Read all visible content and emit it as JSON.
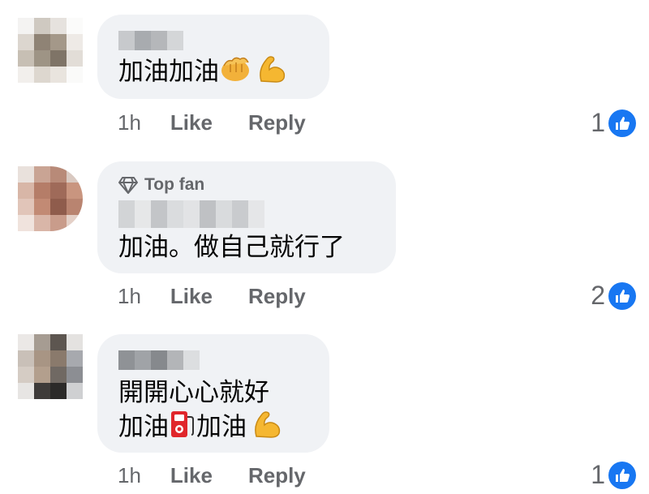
{
  "comments": [
    {
      "text_lines": [
        "加油加油"
      ],
      "emojis": [
        "fist-emoji",
        "flexed-bicep-emoji"
      ],
      "time": "1h",
      "like_label": "Like",
      "reply_label": "Reply",
      "reaction_count": "1"
    },
    {
      "badge": "Top fan",
      "text_lines": [
        "加油。做自己就行了"
      ],
      "time": "1h",
      "like_label": "Like",
      "reply_label": "Reply",
      "reaction_count": "2"
    },
    {
      "text_lines": [
        "開開心心就好",
        "加油",
        "加油"
      ],
      "emojis": [
        "fuel-pump-emoji",
        "flexed-bicep-emoji"
      ],
      "time": "1h",
      "like_label": "Like",
      "reply_label": "Reply",
      "reaction_count": "1"
    }
  ],
  "colors": {
    "bubble": "#f0f2f5",
    "secondary_text": "#65676b",
    "like_blue": "#1877f2"
  }
}
